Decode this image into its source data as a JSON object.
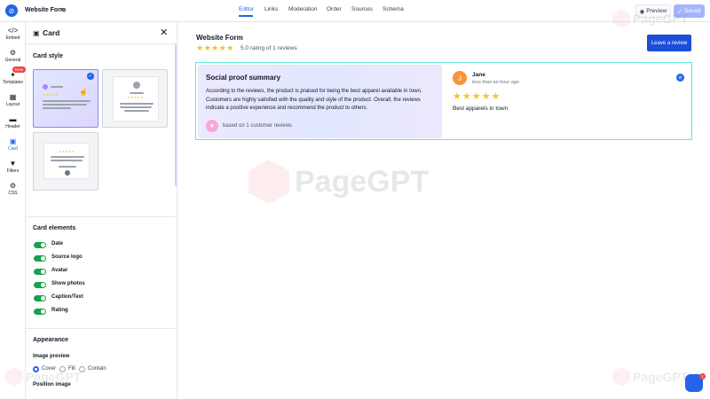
{
  "header": {
    "form_title": "Website Form",
    "tabs": [
      {
        "label": "Editor",
        "active": true
      },
      {
        "label": "Links",
        "active": false
      },
      {
        "label": "Moderation",
        "active": false
      },
      {
        "label": "Order",
        "active": false
      },
      {
        "label": "Sources",
        "active": false
      },
      {
        "label": "Schema",
        "active": false
      }
    ],
    "preview_label": "Preview",
    "saved_label": "Saved"
  },
  "rail": {
    "items": [
      {
        "label": "Embed",
        "icon": "code-icon"
      },
      {
        "label": "General",
        "icon": "gear-icon"
      },
      {
        "label": "Templates",
        "icon": "bulb-icon",
        "badge": "New"
      },
      {
        "label": "Layout",
        "icon": "grid-icon"
      },
      {
        "label": "Header",
        "icon": "header-icon"
      },
      {
        "label": "Card",
        "icon": "card-icon",
        "active": true
      },
      {
        "label": "Filters",
        "icon": "filter-icon"
      },
      {
        "label": "CSS",
        "icon": "gear-icon"
      }
    ]
  },
  "panel": {
    "title": "Card",
    "card_style_title": "Card style",
    "card_elements_title": "Card elements",
    "elements": [
      {
        "label": "Date",
        "on": true
      },
      {
        "label": "Source logo",
        "on": true
      },
      {
        "label": "Avatar",
        "on": true
      },
      {
        "label": "Show photos",
        "on": true
      },
      {
        "label": "Caption/Text",
        "on": true
      },
      {
        "label": "Rating",
        "on": true
      }
    ],
    "appearance_title": "Appearance",
    "image_preview_label": "Image preview",
    "image_preview_options": [
      {
        "label": "Cover",
        "selected": true
      },
      {
        "label": "Fill",
        "selected": false
      },
      {
        "label": "Contain",
        "selected": false
      }
    ],
    "position_image_label": "Position image"
  },
  "widget": {
    "title": "Website Form",
    "rating_text": "5.0 rating of 1 reviews",
    "rating": 5,
    "leave_review_label": "Leave a review",
    "summary": {
      "title": "Social proof summary",
      "body": "According to the reviews, the product is praised for being the best apparel available in town. Customers are highly satisfied with the quality and style of the product. Overall, the reviews indicate a positive experience and recommend the product to others.",
      "footer": "based on 1 customer reviews"
    },
    "review": {
      "avatar_letter": "J",
      "name": "Jane",
      "time": "less than an hour ago",
      "stars": 5,
      "text": "Best apparels in town"
    }
  },
  "watermark": {
    "text": "PageGPT"
  },
  "chat": {
    "badge_count": "1"
  },
  "colors": {
    "accent": "#2563eb",
    "toggle_on": "#16a34a",
    "star": "#fbbf24",
    "frame": "#5eead4"
  }
}
